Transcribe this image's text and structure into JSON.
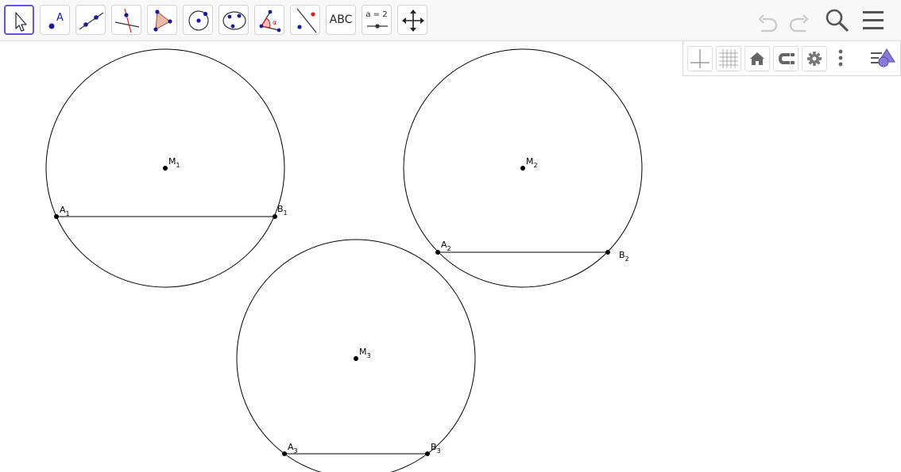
{
  "toolbar": {
    "tools": [
      {
        "name": "move",
        "icon": "move-arrow-icon"
      },
      {
        "name": "point",
        "icon": "point-icon",
        "icon_label": "A"
      },
      {
        "name": "line",
        "icon": "line-through-points-icon"
      },
      {
        "name": "perpendicular",
        "icon": "perpendicular-line-icon"
      },
      {
        "name": "polygon",
        "icon": "polygon-icon"
      },
      {
        "name": "circle",
        "icon": "circle-center-point-icon"
      },
      {
        "name": "conic",
        "icon": "ellipse-icon"
      },
      {
        "name": "angle",
        "icon": "angle-icon",
        "icon_label": "α"
      },
      {
        "name": "reflect",
        "icon": "reflect-about-line-icon"
      },
      {
        "name": "text",
        "icon": "text-icon",
        "label": "ABC"
      },
      {
        "name": "slider",
        "icon": "slider-icon",
        "label": "a = 2"
      },
      {
        "name": "move-graphics",
        "icon": "move-graphics-view-icon"
      }
    ],
    "right": [
      "undo-icon",
      "redo-icon",
      "search-icon",
      "menu-icon"
    ]
  },
  "graphics_style_bar": [
    "axes-icon",
    "grid-icon",
    "home-icon",
    "point-capturing-icon",
    "settings-icon",
    "more-vertical-icon",
    "graphics-style-icon"
  ],
  "construction": {
    "circles": [
      {
        "center": "M",
        "sub": "1",
        "a": "A",
        "a_sub": "1",
        "b": "B",
        "b_sub": "1"
      },
      {
        "center": "M",
        "sub": "2",
        "a": "A",
        "a_sub": "2",
        "b": "B",
        "b_sub": "2"
      },
      {
        "center": "M",
        "sub": "3",
        "a": "A",
        "a_sub": "3",
        "b": "B",
        "b_sub": "3"
      }
    ]
  },
  "colors": {
    "selected_border": "#6557d2",
    "point_blue": "#1a1a9a",
    "polygon_fill": "#e8b8a8",
    "angle_red": "#cc0000"
  }
}
